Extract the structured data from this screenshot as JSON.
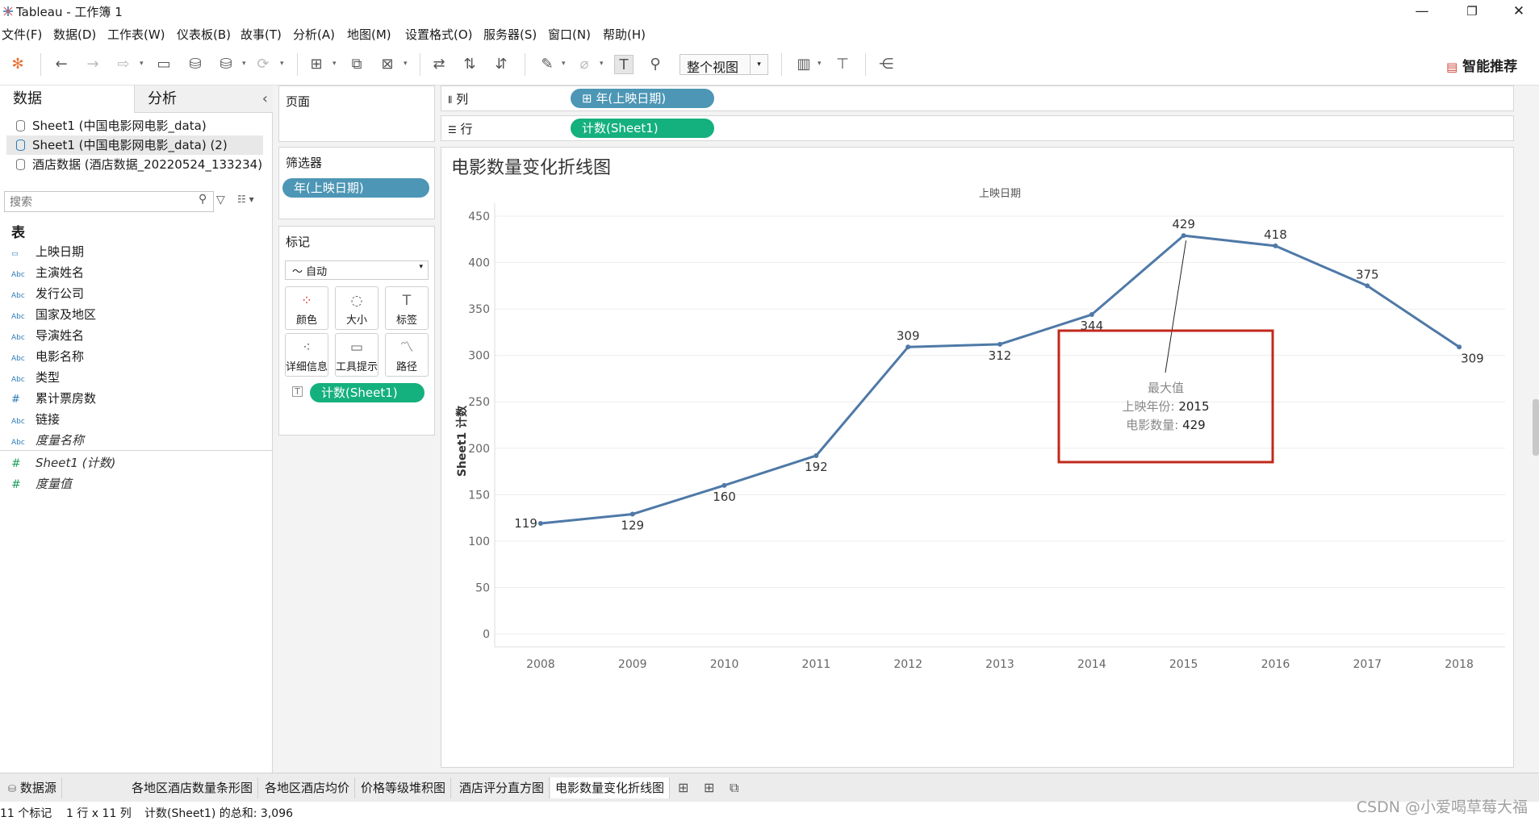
{
  "window": {
    "title": "Tableau - 工作簿 1",
    "minimize": "—",
    "restore": "❐",
    "close": "✕"
  },
  "menu": [
    "文件(F)",
    "数据(D)",
    "工作表(W)",
    "仪表板(B)",
    "故事(T)",
    "分析(A)",
    "地图(M)",
    "设置格式(O)",
    "服务器(S)",
    "窗口(N)",
    "帮助(H)"
  ],
  "toolbar": {
    "fit_value": "整个视图",
    "smart_label": "智能推荐"
  },
  "data_pane": {
    "tab_data": "数据",
    "tab_analysis": "分析",
    "collapse_icon": "‹",
    "datasources": [
      "Sheet1 (中国电影网电影_data)",
      "Sheet1 (中国电影网电影_data) (2)",
      "酒店数据 (酒店数据_20220524_133234)"
    ],
    "search_placeholder": "搜索",
    "tables_header": "表",
    "fields": [
      {
        "type": "date",
        "name": "上映日期"
      },
      {
        "type": "Abc",
        "name": "主演姓名"
      },
      {
        "type": "Abc",
        "name": "发行公司"
      },
      {
        "type": "Abc",
        "name": "国家及地区"
      },
      {
        "type": "Abc",
        "name": "导演姓名"
      },
      {
        "type": "Abc",
        "name": "电影名称"
      },
      {
        "type": "Abc",
        "name": "类型"
      },
      {
        "type": "#",
        "name": "累计票房数"
      },
      {
        "type": "Abc",
        "name": "链接"
      },
      {
        "type": "Abc",
        "name": "度量名称"
      }
    ],
    "measures": [
      {
        "type": "#",
        "name": "Sheet1 (计数)"
      },
      {
        "type": "#",
        "name": "度量值"
      }
    ]
  },
  "shelves": {
    "pages_title": "页面",
    "filters_title": "筛选器",
    "filter_pill": "年(上映日期)",
    "marks_title": "标记",
    "marks_type": "自动",
    "mark_buttons": [
      "颜色",
      "大小",
      "标签",
      "详细信息",
      "工具提示",
      "路径"
    ],
    "marks_pill": "计数(Sheet1)",
    "columns_label": "列",
    "columns_pill": "⊞ 年(上映日期)",
    "rows_label": "行",
    "rows_pill": "计数(Sheet1)"
  },
  "chart_data": {
    "type": "line",
    "title": "电影数量变化折线图",
    "xlabel": "上映日期",
    "ylabel": "Sheet1 计数",
    "categories": [
      "2008",
      "2009",
      "2010",
      "2011",
      "2012",
      "2013",
      "2014",
      "2015",
      "2016",
      "2017",
      "2018"
    ],
    "values": [
      119,
      129,
      160,
      192,
      309,
      312,
      344,
      429,
      418,
      375,
      309
    ],
    "ylim": [
      0,
      450
    ],
    "yticks": [
      0,
      50,
      100,
      150,
      200,
      250,
      300,
      350,
      400,
      450
    ],
    "line_color": "#4e79a7",
    "grid": true,
    "annotation": {
      "title": "最大值",
      "line1_label": "上映年份:",
      "line1_value": "2015",
      "line2_label": "电影数量:",
      "line2_value": "429",
      "box_color": "#c0281b"
    }
  },
  "sheet_tabs": [
    "数据源",
    "各地区酒店数量条形图",
    "各地区酒店均价",
    "价格等级堆积图",
    "酒店评分直方图",
    "电影数量变化折线图"
  ],
  "active_sheet": "电影数量变化折线图",
  "status": {
    "marks": "11 个标记",
    "dims": "1 行 x 11 列",
    "sum": "计数(Sheet1) 的总和: 3,096"
  },
  "watermark": "CSDN @小爱喝草莓大福"
}
